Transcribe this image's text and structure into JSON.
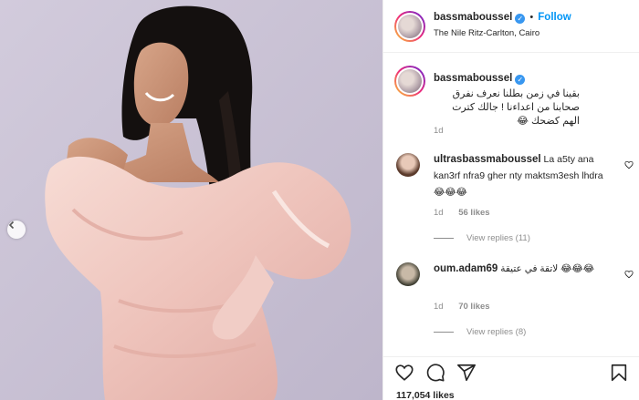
{
  "post": {
    "author": {
      "username": "bassmaboussel",
      "verified": true,
      "follow_label": "Follow",
      "separator": "•",
      "location": "The Nile Ritz-Carlton, Cairo"
    },
    "caption": {
      "username": "bassmaboussel",
      "text": "بقينا في زمن بطلنا نعرف نفرق صحابنا من اعداءنا ! جالك كترت الهم كضحك 😂",
      "age": "1d"
    },
    "comments": [
      {
        "username": "ultrasbassmaboussel",
        "text": "La a5ty ana kan3rf nfra9 gher nty maktsm3esh lhdra 😂😂😂",
        "age": "1d",
        "likes": "56 likes",
        "view_replies": "View replies (11)"
      },
      {
        "username": "oum.adam69",
        "text": "لاتقة في عتيقة 😂😂😂",
        "age": "1d",
        "likes": "70 likes",
        "view_replies": "View replies (8)"
      }
    ],
    "likes_count": "117,054 likes",
    "icons": [
      "heart-icon",
      "comment-icon",
      "share-icon",
      "bookmark-icon",
      "more-options-icon",
      "carousel-prev-icon"
    ],
    "colors": {
      "follow": "#0095f6",
      "verified": "#3897f0",
      "photo_background": "#c9c2d6",
      "dress": "#f2cfc8"
    }
  }
}
